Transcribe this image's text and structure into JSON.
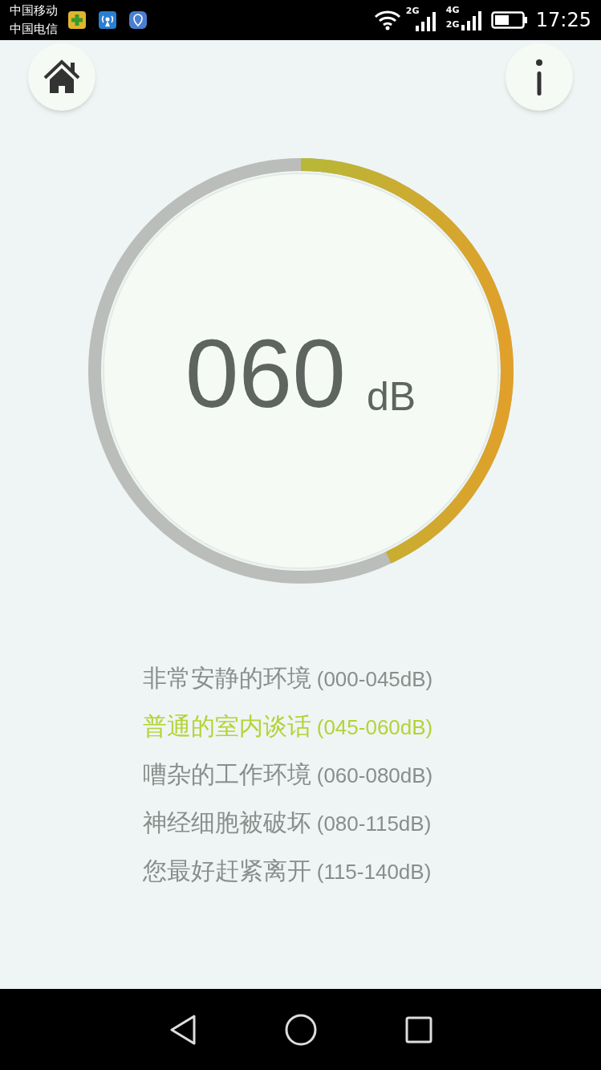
{
  "status_bar": {
    "carriers": [
      "中国移动",
      "中国电信"
    ],
    "network_labels": [
      "2G",
      "4G",
      "2G"
    ],
    "time": "17:25"
  },
  "gauge": {
    "reading": "060",
    "unit": "dB",
    "level": 0.43
  },
  "ranges": [
    {
      "label": "非常安静的环境",
      "range": "(000-045dB)",
      "selected": false
    },
    {
      "label": "普通的室内谈话",
      "range": "(045-060dB)",
      "selected": true
    },
    {
      "label": "嘈杂的工作环境",
      "range": "(060-080dB)",
      "selected": false
    },
    {
      "label": "神经细胞被破坏",
      "range": "(080-115dB)",
      "selected": false
    },
    {
      "label": "您最好赶紧离开",
      "range": "(115-140dB)",
      "selected": false
    }
  ]
}
